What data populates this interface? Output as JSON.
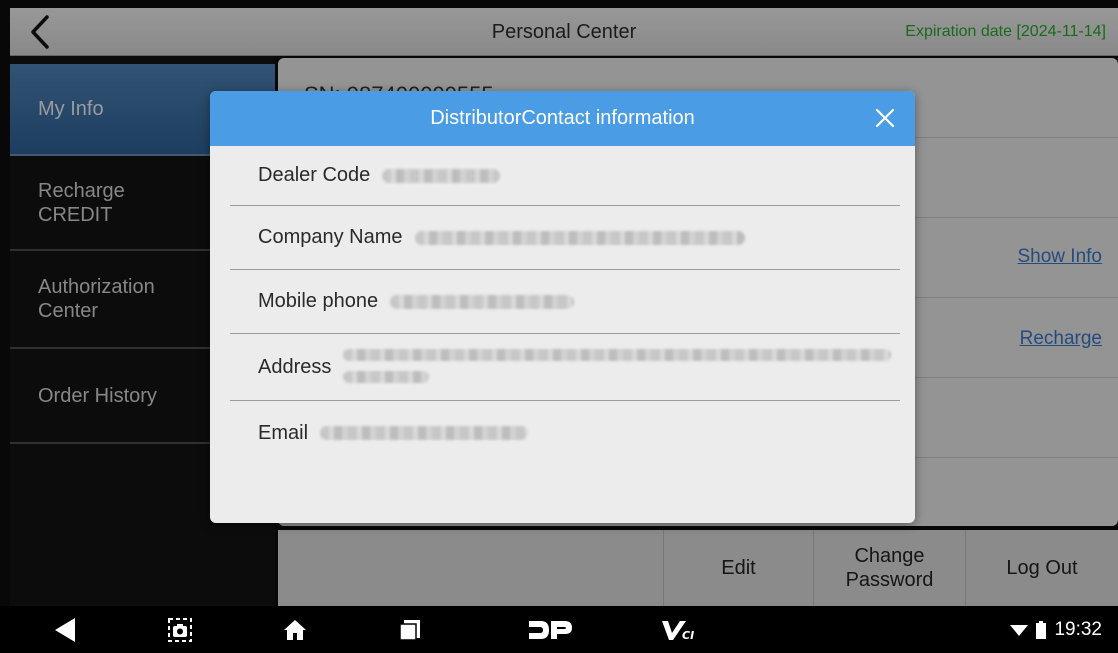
{
  "header": {
    "title": "Personal Center",
    "expiration": "Expiration date [2024-11-14]",
    "back_icon": "chevron-left-icon"
  },
  "sidebar": {
    "items": [
      {
        "label": "My Info",
        "active": true
      },
      {
        "label": "Recharge\nCREDIT",
        "active": false
      },
      {
        "label": "Authorization\nCenter",
        "active": false
      },
      {
        "label": "Order History",
        "active": false
      }
    ]
  },
  "content": {
    "sn_text": "SN: 987400000555",
    "show_info_link": "Show Info",
    "recharge_link": "Recharge"
  },
  "actions": {
    "edit": "Edit",
    "change_password": "Change\nPassword",
    "log_out": "Log Out"
  },
  "modal": {
    "title": "DistributorContact information",
    "close_icon": "close-icon",
    "fields": [
      {
        "label": "Dealer Code"
      },
      {
        "label": "Company Name"
      },
      {
        "label": "Mobile phone"
      },
      {
        "label": "Address"
      },
      {
        "label": "Email"
      }
    ]
  },
  "system_bar": {
    "time": "19:32",
    "icons": [
      "back-triangle-icon",
      "screenshot-icon",
      "home-icon",
      "recents-icon",
      "dp-logo-icon",
      "vci-icon",
      "wifi-icon",
      "battery-icon"
    ]
  },
  "colors": {
    "accent": "#4a9de4",
    "active_sidebar": "#3f70a4",
    "expiration_green": "#27a32a",
    "link_blue": "#3a74c4"
  }
}
